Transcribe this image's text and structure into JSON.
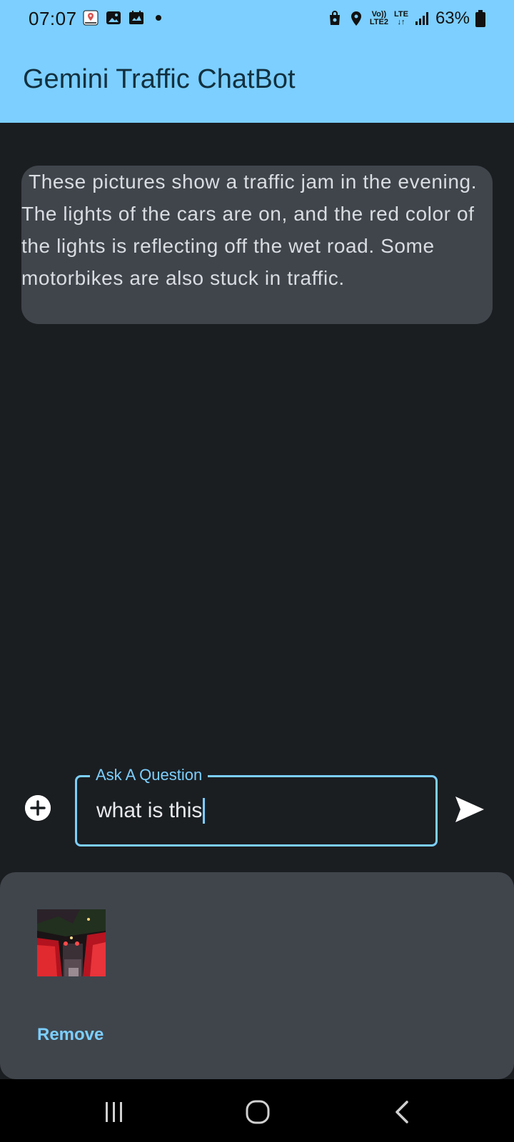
{
  "status_bar": {
    "time": "07:07",
    "left_icons": [
      "maps-notification-icon",
      "gallery-icon",
      "cast-icon"
    ],
    "volte_line1": "Vo))",
    "volte_line2": "LTE2",
    "lte_line1": "LTE",
    "lte_line2": "↓↑",
    "battery_percent": "63%"
  },
  "app_bar": {
    "title": "Gemini Traffic ChatBot"
  },
  "chat": {
    "messages": [
      {
        "role": "bot",
        "text": "These pictures show a traffic jam in the evening. The lights of the cars are on, and the red color of the lights is reflecting off the wet road. Some motorbikes are also stuck in traffic."
      }
    ]
  },
  "composer": {
    "add_icon": "plus-circle-icon",
    "label": "Ask A Question",
    "value": "what is this",
    "send_icon": "send-icon"
  },
  "attachment_sheet": {
    "thumbnail": "traffic-photo-thumbnail",
    "remove_label": "Remove"
  },
  "nav_bar": {
    "recents_icon": "recents-icon",
    "home_icon": "home-icon",
    "back_icon": "back-icon"
  },
  "colors": {
    "app_bar": "#7ccfff",
    "background": "#1b1e21",
    "bubble": "#40454c",
    "accent": "#7ccfff"
  }
}
